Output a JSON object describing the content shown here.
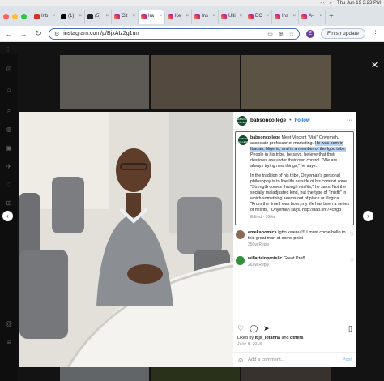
{
  "menubar": {
    "datetime": "Thu Jun 19  3:23 PM"
  },
  "tabs": [
    {
      "label": "Inb",
      "favicon_color": "#d93025"
    },
    {
      "label": "(1)",
      "favicon_color": "#000000"
    },
    {
      "label": "(5)",
      "favicon_color": "#222222"
    },
    {
      "label": "Cit",
      "favicon_color": "instagram"
    },
    {
      "label": "Ira",
      "favicon_color": "instagram"
    },
    {
      "label": "Ke",
      "favicon_color": "instagram"
    },
    {
      "label": "Ins",
      "favicon_color": "instagram"
    },
    {
      "label": "Ulti",
      "favicon_color": "instagram"
    },
    {
      "label": "DC",
      "favicon_color": "instagram"
    },
    {
      "label": "Ins",
      "favicon_color": "instagram"
    },
    {
      "label": "A-",
      "favicon_color": "instagram"
    }
  ],
  "toolbar": {
    "url": "instagram.com/p/BjxAIz2g1ur/",
    "profile_initial": "E",
    "finish_update": "Finish update"
  },
  "post": {
    "username": "babsoncollege",
    "follow_label": "Follow",
    "avatar_text": "BABSON COLLEGE",
    "caption_user": "babsoncollege",
    "caption_p1_a": "Meet Vincent \"Vini\" Onyemah, associate professor of marketing. ",
    "caption_p1_hl": "He was born in Ibadan, Nigeria, and is a member of the Igbo tribe.",
    "caption_p1_b": " People in his tribe, he says, believe that their destinies are under their own control. \"We are always trying new things,\" he says.",
    "caption_p2": "In the tradition of his tribe, Onyemah's personal philosophy is to live life outside of his comfort zone. \"Strength comes through misfits,\" he says. Not the socially maladjusted kind, but the type of \"misfit\" in which something seems out of place or illogical. \"From the time I was born, my life has been a series of misfits,\" Onyemah says. http://bab.sn/74c9gd",
    "caption_meta": "Edited · 366w",
    "comments": [
      {
        "user": "emekanomics",
        "text": "Igbo kwenu!!!! I must come hello to this great man at some point",
        "meta": "350w   Reply",
        "avatar_color": "#8a6a55"
      },
      {
        "user": "willattainprotsllc",
        "text": "Great Prof!",
        "meta": "269w   Reply",
        "avatar_color": "#2f8f3a"
      }
    ],
    "liked_by_prefix": "Liked by ",
    "liked_by_user": "itijs_lotanna",
    "liked_by_mid": " and ",
    "liked_by_others": "others",
    "date": "June 6, 2018",
    "add_comment_placeholder": "Add a comment...",
    "post_label": "Post"
  },
  "icons": {
    "back": "←",
    "forward": "→",
    "reload": "↻",
    "close_modal": "✕",
    "prev": "‹",
    "next": "›",
    "more": "···"
  }
}
